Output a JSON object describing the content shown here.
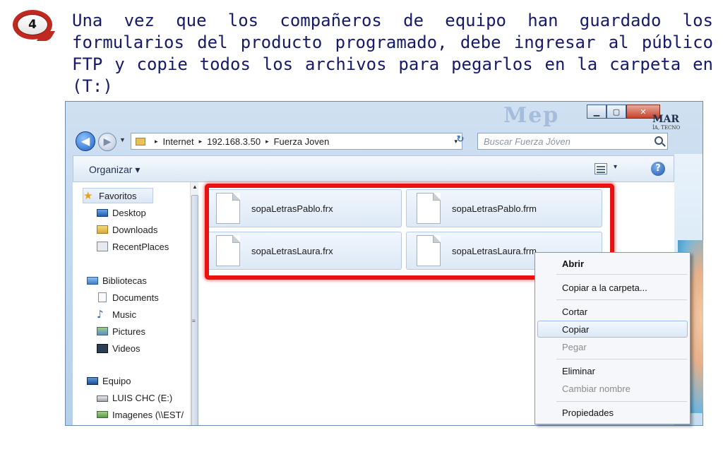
{
  "step": {
    "number": "4"
  },
  "instruction": "Una vez que los compañeros de equipo han guardado los formularios del producto programado, debe ingresar al público FTP y copie todos los archivos para pegarlos en la carpeta en (T:)",
  "window": {
    "controls": {
      "minimize": "▁",
      "maximize": "▢",
      "close": "✕"
    },
    "watermark": "Mep",
    "address_bar": {
      "crumbs": [
        "Internet",
        "192.168.3.50",
        "Fuerza Joven"
      ],
      "separator": "▸",
      "dropdown": "▾"
    },
    "refresh": "↻",
    "search_placeholder": "Buscar Fuerza Jóven",
    "toolbar": {
      "organize_label": "Organizar ▾",
      "views_dropdown": "▾",
      "help": "?"
    }
  },
  "nav": {
    "favorites": {
      "label": "Favoritos",
      "items": [
        "Desktop",
        "Downloads",
        "RecentPlaces"
      ]
    },
    "libraries": {
      "label": "Bibliotecas",
      "items": [
        "Documents",
        "Music",
        "Pictures",
        "Videos"
      ]
    },
    "computer": {
      "label": "Equipo",
      "items": [
        "LUIS CHC (E:)",
        "Imagenes (\\\\EST/"
      ]
    },
    "scroll_up": "▲",
    "scroll_grip": "≡"
  },
  "files": [
    {
      "name": "sopaLetrasPablo.frx"
    },
    {
      "name": "sopaLetrasPablo.frm"
    },
    {
      "name": "sopaLetrasLaura.frx"
    },
    {
      "name": "sopaLetrasLaura.frm"
    }
  ],
  "brand": {
    "text": "MAR",
    "sub": "ÍA, TECNO"
  },
  "context_menu": {
    "items": [
      {
        "label": "Abrir",
        "style": "bold"
      },
      {
        "label": "Copiar a la carpeta...",
        "style": "normal"
      },
      {
        "label": "Cortar",
        "style": "normal"
      },
      {
        "label": "Copiar",
        "style": "hover"
      },
      {
        "label": "Pegar",
        "style": "disabled"
      },
      {
        "label": "Eliminar",
        "style": "normal"
      },
      {
        "label": "Cambiar nombre",
        "style": "disabled"
      },
      {
        "label": "Propiedades",
        "style": "normal"
      }
    ]
  },
  "colors": {
    "highlight_frame": "#e81212",
    "instruction_text": "#151a6b",
    "badge": "#c0291f"
  }
}
